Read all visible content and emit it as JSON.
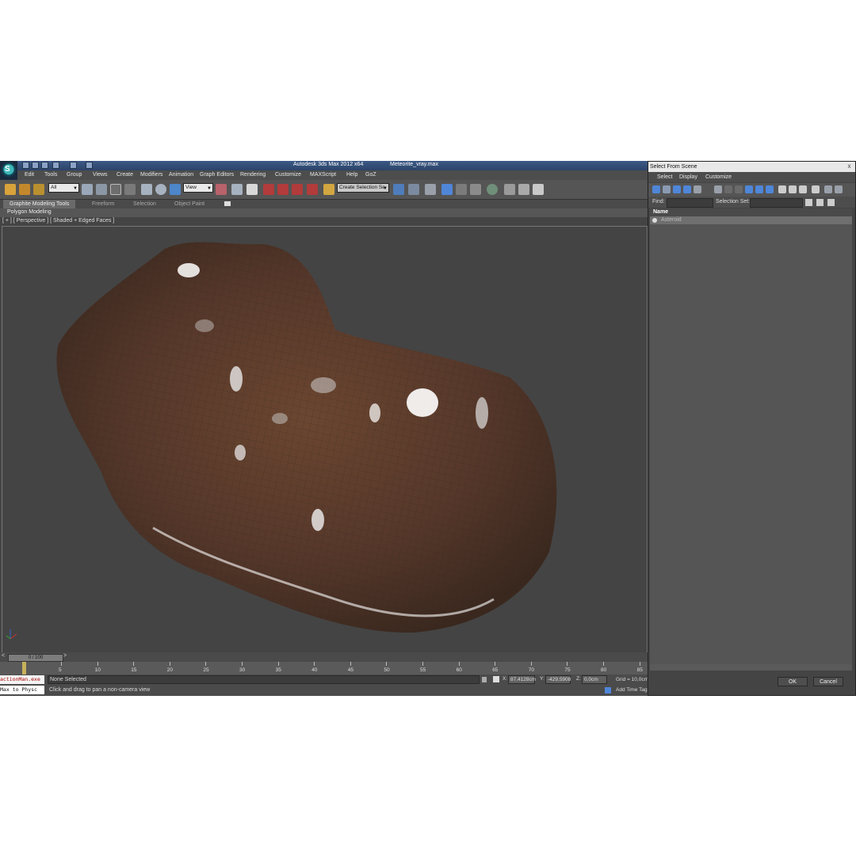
{
  "window": {
    "app_title": "Autodesk 3ds Max  2012 x64",
    "file_title": "Meteorite_vray.max",
    "logo_letter": "S"
  },
  "menubar": [
    "Edit",
    "Tools",
    "Group",
    "Views",
    "Create",
    "Modifiers",
    "Animation",
    "Graph Editors",
    "Rendering",
    "Customize",
    "MAXScript",
    "Help",
    "GoZ"
  ],
  "toolbar": {
    "selection_filter": "All",
    "reference_coord": "View",
    "named_selection": "Create Selection Se",
    "snap_labels": [
      "3",
      "2.5",
      "%n"
    ]
  },
  "ribbon": {
    "tabs": [
      "Graphite Modeling Tools",
      "Freeform",
      "Selection",
      "Object Paint"
    ],
    "panel": "Polygon Modeling"
  },
  "viewport": {
    "label": "[ + ] [ Perspective ] [ Shaded + Edged Faces ]"
  },
  "timeline": {
    "slider_label": "0 / 100",
    "ticks": [
      "5",
      "10",
      "15",
      "20",
      "25",
      "30",
      "35",
      "40",
      "45",
      "50",
      "55",
      "60",
      "65",
      "70",
      "75",
      "80",
      "85"
    ]
  },
  "status": {
    "maxscript_input": "actionMan.exe",
    "maxscript_output": "Max to Physc",
    "selection": "None Selected",
    "prompt": "Click and drag to pan a non-camera view",
    "x_label": "X:",
    "x_value": "87,4128cm",
    "y_label": "Y:",
    "y_value": "-429,5908",
    "z_label": "Z:",
    "z_value": "0,0cm",
    "grid": "Grid = 10,0cm",
    "add_time_tag": "Add Time Tag"
  },
  "dialog": {
    "title": "Select From Scene",
    "close_glyph": "x",
    "menu": [
      "Select",
      "Display",
      "Customize"
    ],
    "find_label": "Find:",
    "selection_set_label": "Selection Set:",
    "column_name": "Name",
    "items": [
      "Asteroid"
    ],
    "ok_label": "OK",
    "cancel_label": "Cancel"
  },
  "colors": {
    "title_blue": "#2f4a74",
    "ui_dark": "#444444",
    "rock_brown": "#5a3a26"
  }
}
